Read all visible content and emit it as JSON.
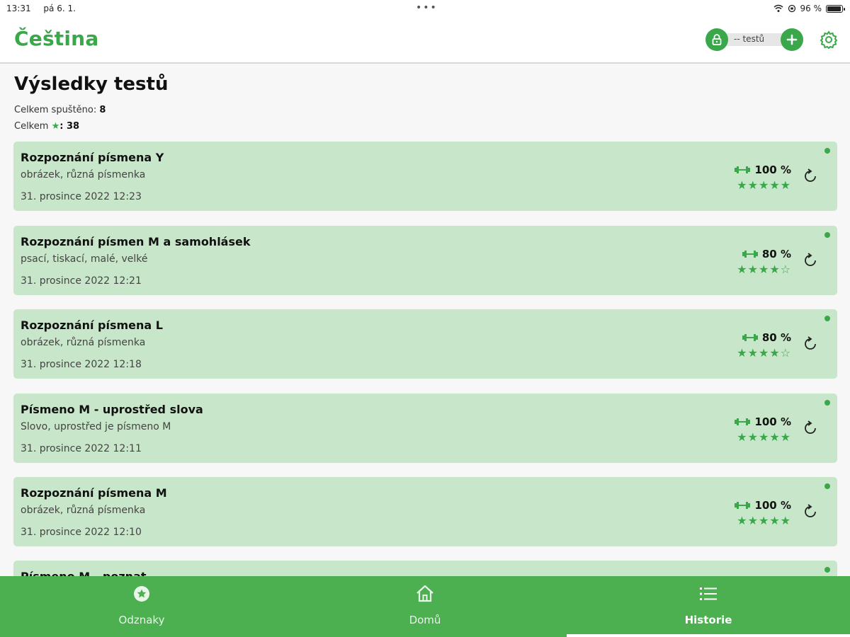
{
  "statusbar": {
    "time": "13:31",
    "date": "pá 6. 1.",
    "battery": "96 %",
    "battery_level": 0.96
  },
  "appbar": {
    "title": "Čeština",
    "tests_label": "-- testů"
  },
  "page": {
    "title": "Výsledky testů",
    "total_runs_label": "Celkem spuštěno:",
    "total_runs_value": "8",
    "total_stars_label": "Celkem",
    "total_stars_value": ": 38"
  },
  "results": [
    {
      "title": "Rozpoznání písmena Y",
      "subtitle": "obrázek, různá písmenka",
      "date": "31. prosince 2022 12:23",
      "score": "100 %",
      "stars": "★★★★★",
      "star_count": 5
    },
    {
      "title": "Rozpoznání písmen M a samohlásek",
      "subtitle": "psací, tiskací, malé, velké",
      "date": "31. prosince 2022 12:21",
      "score": "80 %",
      "stars": "★★★★☆",
      "star_count": 4
    },
    {
      "title": "Rozpoznání písmena L",
      "subtitle": "obrázek, různá písmenka",
      "date": "31. prosince 2022 12:18",
      "score": "80 %",
      "stars": "★★★★☆",
      "star_count": 4
    },
    {
      "title": "Písmeno M - uprostřed slova",
      "subtitle": "Slovo, uprostřed je písmeno M",
      "date": "31. prosince 2022 12:11",
      "score": "100 %",
      "stars": "★★★★★",
      "star_count": 5
    },
    {
      "title": "Rozpoznání písmena M",
      "subtitle": "obrázek, různá písmenka",
      "date": "31. prosince 2022 12:10",
      "score": "100 %",
      "stars": "★★★★★",
      "star_count": 5
    },
    {
      "title": "Písmeno M - poznat",
      "subtitle": "",
      "date": "",
      "score": "",
      "stars": "",
      "star_count": 0
    }
  ],
  "nav": {
    "badges": "Odznaky",
    "home": "Domů",
    "history": "Historie",
    "active": "history"
  },
  "colors": {
    "accent": "#3aa84a",
    "nav_bg": "#4caf50",
    "card_bg": "#c8e6c9"
  }
}
